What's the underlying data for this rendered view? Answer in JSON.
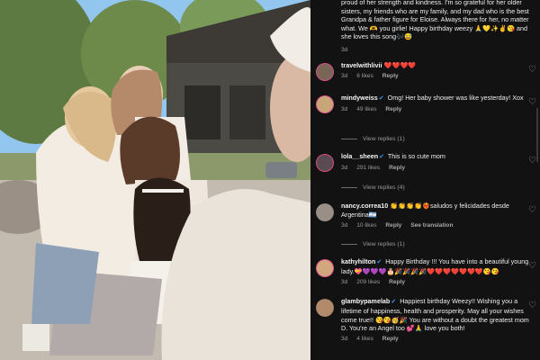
{
  "photo": {
    "description_icon": "photo-icon"
  },
  "top_comment": {
    "text": "proud of her strength and kindness. I'm so grateful for her older sisters, my friends who are my family, and my dad who is the best Grandpa & father figure for Eloise. Always there for her, no matter what. We 🫶 you girlie! Happy birthday weezy 🙏💛✨✌️😘 and she loves this song🎶😅",
    "time": "3d"
  },
  "comments": [
    {
      "username": "travelwithlivii",
      "verified": false,
      "text": "❤️❤️❤️❤️",
      "time": "3d",
      "likes": "6 likes",
      "reply": "Reply",
      "translation": "",
      "view_replies": "",
      "avatar_color": "#7a6656"
    },
    {
      "username": "mindyweiss",
      "verified": true,
      "text": "Omg! Her baby shower was like yesterday! Xox",
      "time": "3d",
      "likes": "49 likes",
      "reply": "Reply",
      "translation": "",
      "view_replies": "View replies (1)",
      "avatar_color": "#c8a678"
    },
    {
      "username": "lola__sheen",
      "verified": true,
      "text": "This is so cute mom",
      "time": "3d",
      "likes": "291 likes",
      "reply": "Reply",
      "translation": "",
      "view_replies": "View replies (4)",
      "avatar_color": "#5a4a52"
    },
    {
      "username": "nancy.correa10",
      "verified": false,
      "text": "👏👏👏👏❤️‍🔥saludos y felicidades desde Argentina🇦🇷",
      "time": "3d",
      "likes": "10 likes",
      "reply": "Reply",
      "translation": "See translation",
      "view_replies": "View replies (1)",
      "avatar_color": "#9a8f86"
    },
    {
      "username": "kathyhilton",
      "verified": true,
      "text": "Happy Birthday !!! You have into a beautiful young lady.💝💜💜💜🎂🎉🎉🎉🎉❤️❤️❤️❤️❤️❤️❤️😘😘",
      "time": "3d",
      "likes": "209 likes",
      "reply": "Reply",
      "translation": "",
      "view_replies": "",
      "avatar_color": "#d2a77d"
    },
    {
      "username": "glambypamelab",
      "verified": true,
      "text": "Happiest birthday Weezy!! Wishing you a lifetime of happiness, health and prosperity. May all your wishes come true!! 😘😘🥳🎉 You are without a doubt the greatest mom D. You're an Angel too 💕🙏 love you both!",
      "time": "3d",
      "likes": "4 likes",
      "reply": "Reply",
      "translation": "",
      "view_replies": "",
      "avatar_color": "#b08a6b"
    }
  ],
  "icons": {
    "heart": "heart-icon",
    "verified": "verified-badge-icon"
  }
}
